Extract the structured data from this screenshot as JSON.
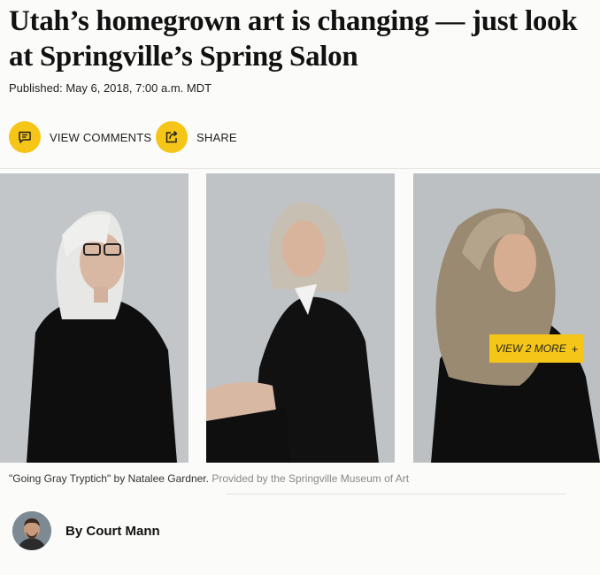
{
  "article": {
    "headline": "Utah’s homegrown art is changing — just look at Springville’s Spring Salon",
    "published": "Published: May 6, 2018, 7:00 a.m. MDT"
  },
  "actions": {
    "comments_label": "VIEW COMMENTS",
    "comments_icon": "comment-icon",
    "share_label": "SHARE",
    "share_icon": "share-icon",
    "accent_color": "#f5c518"
  },
  "gallery": {
    "view_more_label": "VIEW 2 MORE",
    "view_more_plus": "+",
    "caption_title": "\"Going Gray Tryptich\" by Natalee Gardner.",
    "caption_credit": "Provided by the Springville Museum of Art"
  },
  "byline": {
    "prefix": "By",
    "author": "Court Mann"
  }
}
